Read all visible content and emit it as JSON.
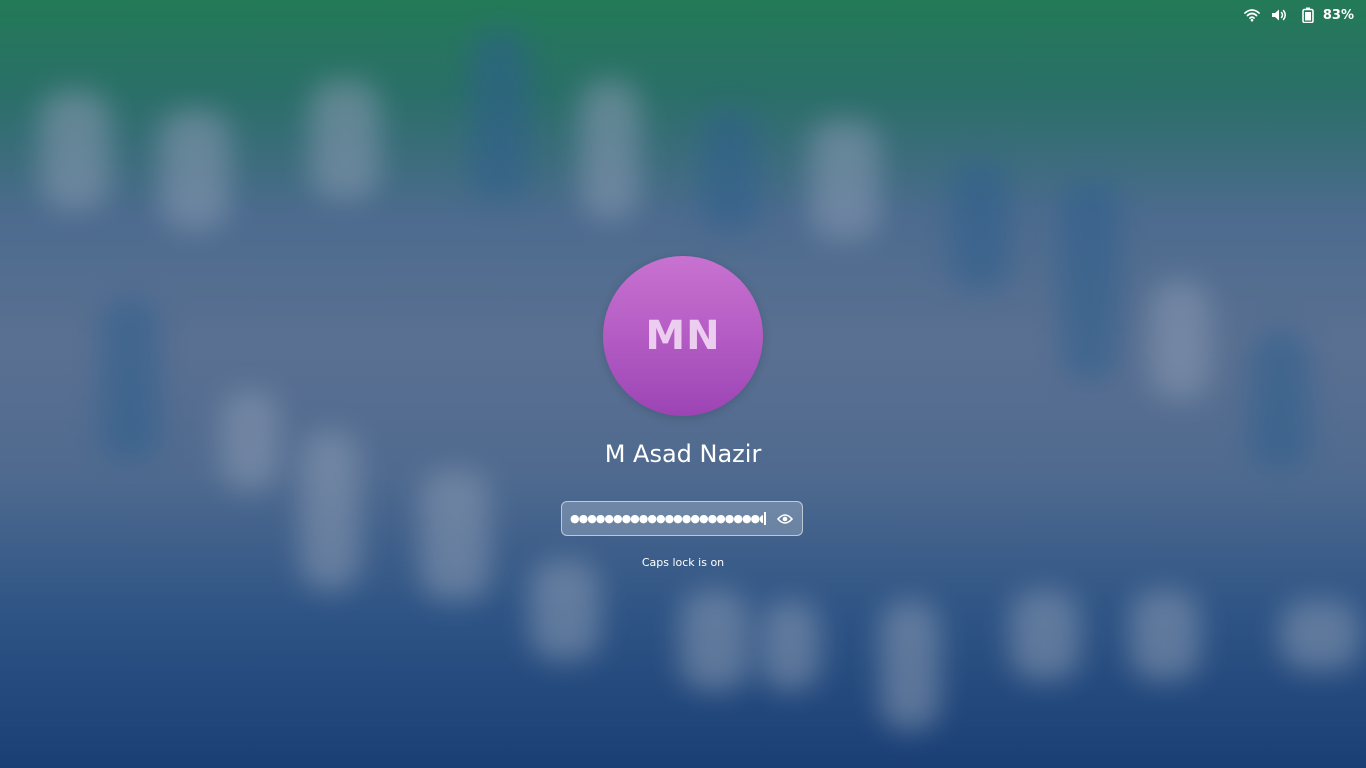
{
  "top_panel": {
    "network_icon": "wifi-icon",
    "volume_icon": "volume-icon",
    "battery_icon": "battery-icon",
    "battery_percent": "83%"
  },
  "user": {
    "initials": "MN",
    "name": "M Asad Nazir"
  },
  "password": {
    "masked_value": "●●●●●●●●●●●●●●●●●●●●●●●●●●",
    "reveal_icon": "eye-icon"
  },
  "status": {
    "caps_lock_message": "Caps lock is on"
  },
  "colors": {
    "avatar_top": "#c872d0",
    "avatar_bottom": "#9c44b4",
    "bg_top": "#237a57",
    "bg_bottom": "#1a3f75"
  }
}
